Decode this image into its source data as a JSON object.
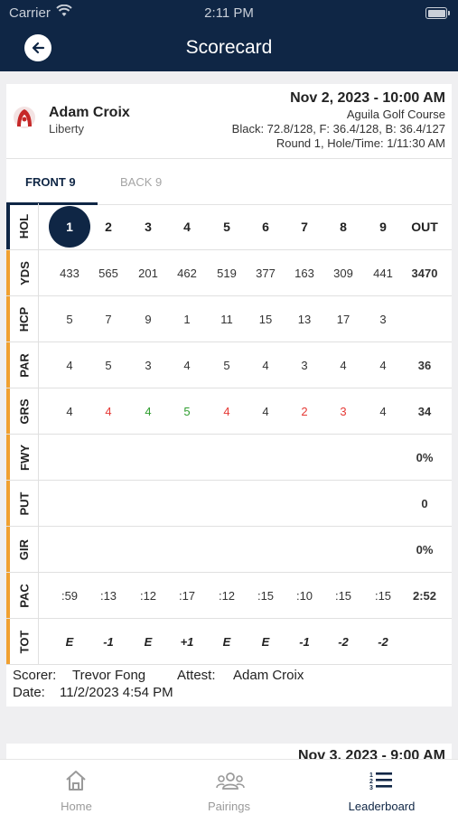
{
  "status_bar": {
    "carrier": "Carrier",
    "time": "2:11 PM"
  },
  "header": {
    "title": "Scorecard"
  },
  "player": {
    "name": "Adam Croix",
    "team": "Liberty"
  },
  "round": {
    "datetime": "Nov 2, 2023 - 10:00 AM",
    "course": "Aguila Golf Course",
    "tees": "Black: 72.8/128, F: 36.4/128, B: 36.4/127",
    "round_info": "Round 1, Hole/Time: 1/11:30 AM"
  },
  "tabs": {
    "front": "FRONT 9",
    "back": "BACK 9",
    "active": "front"
  },
  "scorecard": {
    "current_hole": "1",
    "rows": [
      {
        "key": "hol",
        "label": "HOL",
        "values": [
          "1",
          "2",
          "3",
          "4",
          "5",
          "6",
          "7",
          "8",
          "9"
        ],
        "total": "OUT"
      },
      {
        "key": "yds",
        "label": "YDS",
        "values": [
          "433",
          "565",
          "201",
          "462",
          "519",
          "377",
          "163",
          "309",
          "441"
        ],
        "total": "3470"
      },
      {
        "key": "hcp",
        "label": "HCP",
        "values": [
          "5",
          "7",
          "9",
          "1",
          "11",
          "15",
          "13",
          "17",
          "3"
        ],
        "total": ""
      },
      {
        "key": "par",
        "label": "PAR",
        "values": [
          "4",
          "5",
          "3",
          "4",
          "5",
          "4",
          "3",
          "4",
          "4"
        ],
        "total": "36"
      },
      {
        "key": "grs",
        "label": "GRS",
        "values": [
          "4",
          "4",
          "4",
          "5",
          "4",
          "4",
          "2",
          "3",
          "4"
        ],
        "total": "34"
      },
      {
        "key": "fwy",
        "label": "FWY",
        "values": [
          "",
          "",
          "",
          "",
          "",
          "",
          "",
          "",
          ""
        ],
        "total": "0%"
      },
      {
        "key": "put",
        "label": "PUT",
        "values": [
          "",
          "",
          "",
          "",
          "",
          "",
          "",
          "",
          ""
        ],
        "total": "0"
      },
      {
        "key": "gir",
        "label": "GIR",
        "values": [
          "",
          "",
          "",
          "",
          "",
          "",
          "",
          "",
          ""
        ],
        "total": "0%"
      },
      {
        "key": "pac",
        "label": "PAC",
        "values": [
          ":59",
          ":13",
          ":12",
          ":17",
          ":12",
          ":15",
          ":10",
          ":15",
          ":15"
        ],
        "total": "2:52"
      },
      {
        "key": "tot",
        "label": "TOT",
        "values": [
          "E",
          "-1",
          "E",
          "+1",
          "E",
          "E",
          "-1",
          "-2",
          "-2"
        ],
        "total": ""
      }
    ],
    "grs_colors": [
      "#333333",
      "#e53935",
      "#2e9d2e",
      "#2e9d2e",
      "#e53935",
      "#333333",
      "#e53935",
      "#e53935",
      "#333333"
    ]
  },
  "footer": {
    "scorer_label": "Scorer:",
    "scorer": "Trevor Fong",
    "attest_label": "Attest:",
    "attest": "Adam Croix",
    "date_label": "Date:",
    "date": "11/2/2023 4:54 PM"
  },
  "next_card": {
    "datetime": "Nov 3, 2023 - 9:00 AM"
  },
  "tab_bar": [
    {
      "label": "Home",
      "icon": "home-icon"
    },
    {
      "label": "Pairings",
      "icon": "group-icon"
    },
    {
      "label": "Leaderboard",
      "icon": "ranked-list-icon",
      "active": true
    }
  ],
  "colors": {
    "navy": "#0f2645",
    "accent_orange": "#f0a030",
    "over_par": "#e53935",
    "under_par": "#2e9d2e"
  }
}
